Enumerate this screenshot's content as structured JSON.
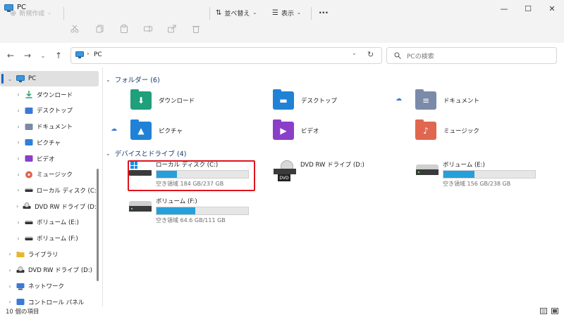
{
  "window": {
    "title": "PC",
    "minimize": "—",
    "maximize": "☐",
    "close": "✕"
  },
  "toolbar": {
    "new_label": "新規作成",
    "sort_label": "並べ替え",
    "view_label": "表示",
    "more_label": "···"
  },
  "address": {
    "path": "PC",
    "search_placeholder": "PCの検索"
  },
  "sidebar": {
    "items": [
      {
        "label": "PC",
        "indent": 0,
        "expanded": true,
        "icon": "pc-icon",
        "color": "#3a96dd"
      },
      {
        "label": "ダウンロード",
        "indent": 1,
        "icon": "download-icon",
        "color": "#2e9e6e"
      },
      {
        "label": "デスクトップ",
        "indent": 1,
        "icon": "desktop-icon",
        "color": "#3a7bd5"
      },
      {
        "label": "ドキュメント",
        "indent": 1,
        "icon": "documents-icon",
        "color": "#7a8aa3"
      },
      {
        "label": "ピクチャ",
        "indent": 1,
        "icon": "pictures-icon",
        "color": "#2f7fd6"
      },
      {
        "label": "ビデオ",
        "indent": 1,
        "icon": "videos-icon",
        "color": "#8a3fc9"
      },
      {
        "label": "ミュージック",
        "indent": 1,
        "icon": "music-icon",
        "color": "#e0674f"
      },
      {
        "label": "ローカル ディスク (C:)",
        "indent": 1,
        "icon": "drive-icon",
        "color": "#555555"
      },
      {
        "label": "DVD RW ドライブ (D:)",
        "indent": 1,
        "icon": "dvd-icon",
        "color": "#555555"
      },
      {
        "label": "ボリューム (E:)",
        "indent": 1,
        "icon": "drive-icon",
        "color": "#555555"
      },
      {
        "label": "ボリューム (F:)",
        "indent": 1,
        "icon": "drive-icon",
        "color": "#555555"
      },
      {
        "label": "ライブラリ",
        "indent": 0,
        "icon": "library-icon",
        "color": "#e8b62c"
      },
      {
        "label": "DVD RW ドライブ (D:)",
        "indent": 0,
        "icon": "dvd-icon",
        "color": "#555555"
      },
      {
        "label": "ネットワーク",
        "indent": 0,
        "icon": "network-icon",
        "color": "#3a7bd5"
      },
      {
        "label": "コントロール パネル",
        "indent": 0,
        "icon": "control-panel-icon",
        "color": "#3a7bd5"
      }
    ]
  },
  "folders_section": {
    "title": "フォルダー (6)",
    "items": [
      {
        "label": "ダウンロード",
        "icon": "download-folder-icon",
        "color": "#1f9f7a",
        "glyph": "⬇",
        "cloud": false
      },
      {
        "label": "デスクトップ",
        "icon": "desktop-folder-icon",
        "color": "#1f82d6",
        "glyph": "▬",
        "cloud": false
      },
      {
        "label": "ドキュメント",
        "icon": "documents-folder-icon",
        "color": "#7b8aa8",
        "glyph": "≡",
        "cloud": true
      },
      {
        "label": "ピクチャ",
        "icon": "pictures-folder-icon",
        "color": "#1f82d6",
        "glyph": "▲",
        "cloud": true
      },
      {
        "label": "ビデオ",
        "icon": "videos-folder-icon",
        "color": "#8b3fc9",
        "glyph": "▶",
        "cloud": false
      },
      {
        "label": "ミュージック",
        "icon": "music-folder-icon",
        "color": "#e0674f",
        "glyph": "♪",
        "cloud": false
      }
    ]
  },
  "drives_section": {
    "title": "デバイスとドライブ (4)",
    "items": [
      {
        "name": "ローカル ディスク (C:)",
        "size": "空き領域 184 GB/237 GB",
        "used_fraction": 0.22,
        "icon": "windows-drive-icon",
        "has_bar": true
      },
      {
        "name": "DVD RW ドライブ (D:)",
        "size": "",
        "used_fraction": 0,
        "icon": "dvd-drive-icon",
        "has_bar": false
      },
      {
        "name": "ボリューム (E:)",
        "size": "空き領域 156 GB/238 GB",
        "used_fraction": 0.34,
        "icon": "drive-icon",
        "has_bar": true
      },
      {
        "name": "ボリューム (F:)",
        "size": "空き領域 64.6 GB/111 GB",
        "used_fraction": 0.42,
        "icon": "drive-icon",
        "has_bar": true
      }
    ]
  },
  "status": {
    "count": "10 個の項目"
  },
  "colors": {
    "accent": "#0067c0",
    "progress": "#26a0da",
    "highlight": "#e0141e"
  }
}
